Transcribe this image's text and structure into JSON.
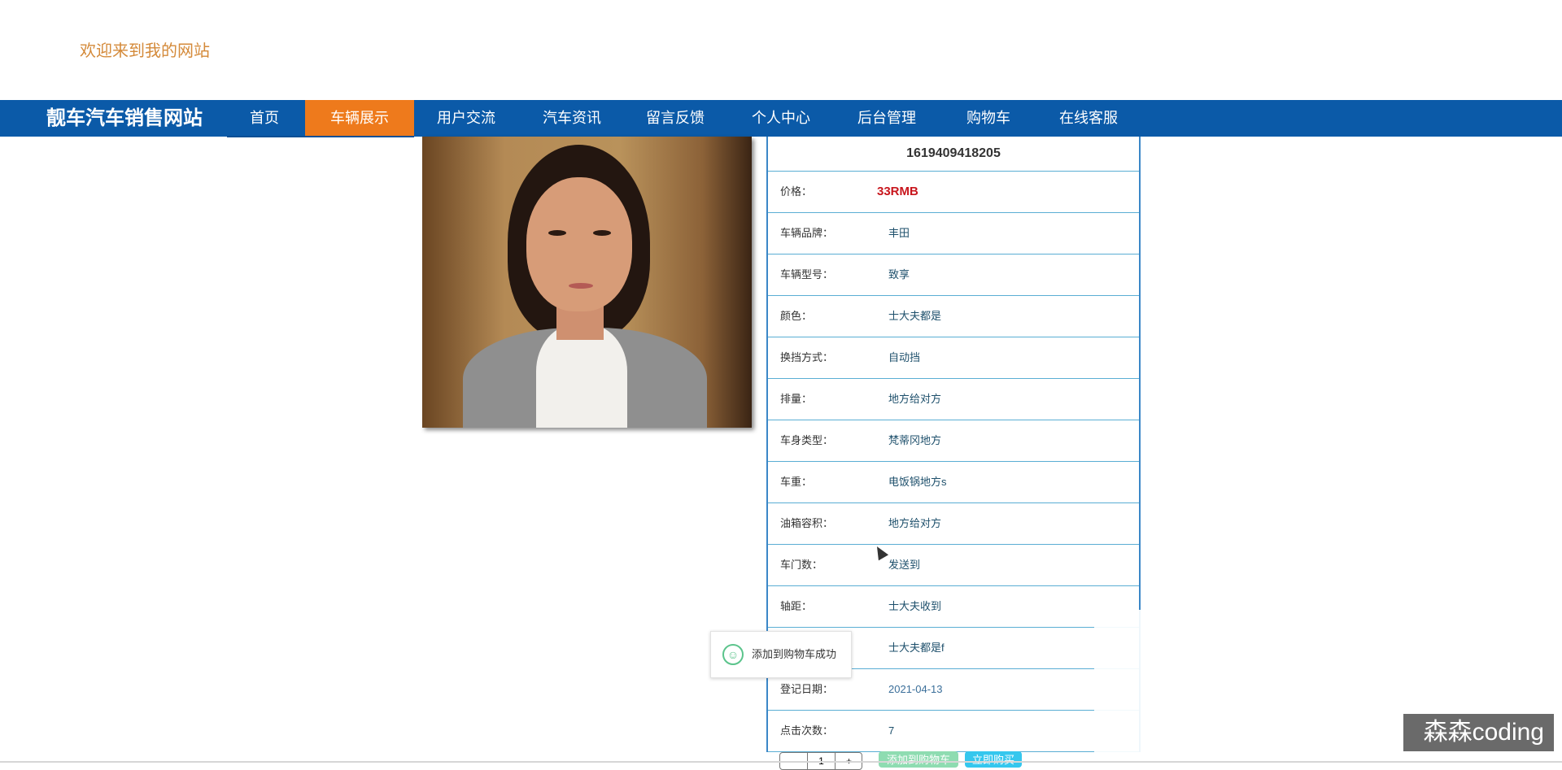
{
  "header": {
    "welcome": "欢迎来到我的网站"
  },
  "nav": {
    "brand": "靓车汽车销售网站",
    "items": [
      {
        "label": "首页"
      },
      {
        "label": "车辆展示"
      },
      {
        "label": "用户交流"
      },
      {
        "label": "汽车资讯"
      },
      {
        "label": "留言反馈"
      },
      {
        "label": "个人中心"
      },
      {
        "label": "后台管理"
      },
      {
        "label": "购物车"
      },
      {
        "label": "在线客服"
      }
    ],
    "active_index": 1,
    "colors": {
      "bar": "#0b5aa8",
      "active": "#ee7a1c"
    }
  },
  "detail": {
    "title": "1619409418205",
    "rows": [
      {
        "label": "价格：",
        "value": "33RMB"
      },
      {
        "label": "车辆品牌：",
        "value": "丰田"
      },
      {
        "label": "车辆型号：",
        "value": "致享"
      },
      {
        "label": "颜色：",
        "value": "士大夫都是"
      },
      {
        "label": "换挡方式：",
        "value": "自动挡"
      },
      {
        "label": "排量：",
        "value": "地方给对方"
      },
      {
        "label": "车身类型：",
        "value": "梵蒂冈地方"
      },
      {
        "label": "车重：",
        "value": "电饭锅地方s"
      },
      {
        "label": "油箱容积：",
        "value": "地方给对方"
      },
      {
        "label": "车门数：",
        "value": "发送到"
      },
      {
        "label": "轴距：",
        "value": "士大夫收到"
      },
      {
        "label": "",
        "value": "士大夫都是f"
      },
      {
        "label": "登记日期：",
        "value": "2021-04-13"
      },
      {
        "label": "点击次数：",
        "value": "7"
      }
    ],
    "price_color": "#c8161d"
  },
  "cart": {
    "quantity": "1",
    "minus": "-",
    "plus": "+",
    "add_label": "添加到购物车",
    "buy_label": "立即购买"
  },
  "toast": {
    "message": "添加到购物车成功",
    "icon": "smile-icon"
  },
  "watermark": "森森coding"
}
